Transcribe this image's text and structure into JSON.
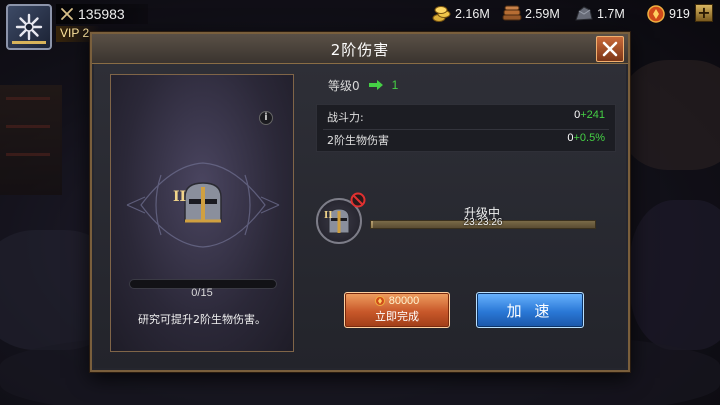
{
  "hud": {
    "power": "135983",
    "vip": "VIP 2",
    "resources": [
      {
        "icon": "gold-coins-icon",
        "value": "2.16M"
      },
      {
        "icon": "wood-logs-icon",
        "value": "2.59M"
      },
      {
        "icon": "iron-ore-icon",
        "value": "1.7M"
      },
      {
        "icon": "gem-icon",
        "value": "919"
      }
    ],
    "plus_label": "+"
  },
  "modal": {
    "title": "2阶伤害",
    "card": {
      "info_label": "i",
      "progress": {
        "current": 0,
        "max": 15,
        "text": "0/15"
      },
      "description": "研究可提升2阶生物伤害。"
    },
    "level": {
      "current": "等级0",
      "next": "1"
    },
    "stats": [
      {
        "name": "战斗力:",
        "base": "0",
        "bonus": "+241"
      },
      {
        "name": "2阶生物伤害",
        "base": "0",
        "bonus": "+0.5%"
      }
    ],
    "upgrade": {
      "status": "升级中",
      "timer": "23:23:26",
      "progress": 0.01
    },
    "buttons": {
      "complete_cost": "80000",
      "complete_label": "立即完成",
      "speed_label": "加 速"
    }
  },
  "colors": {
    "accent_green": "#45d045",
    "frame_gold": "#7a5f3c",
    "button_orange": "#c8582a",
    "button_blue": "#2a78d6"
  }
}
